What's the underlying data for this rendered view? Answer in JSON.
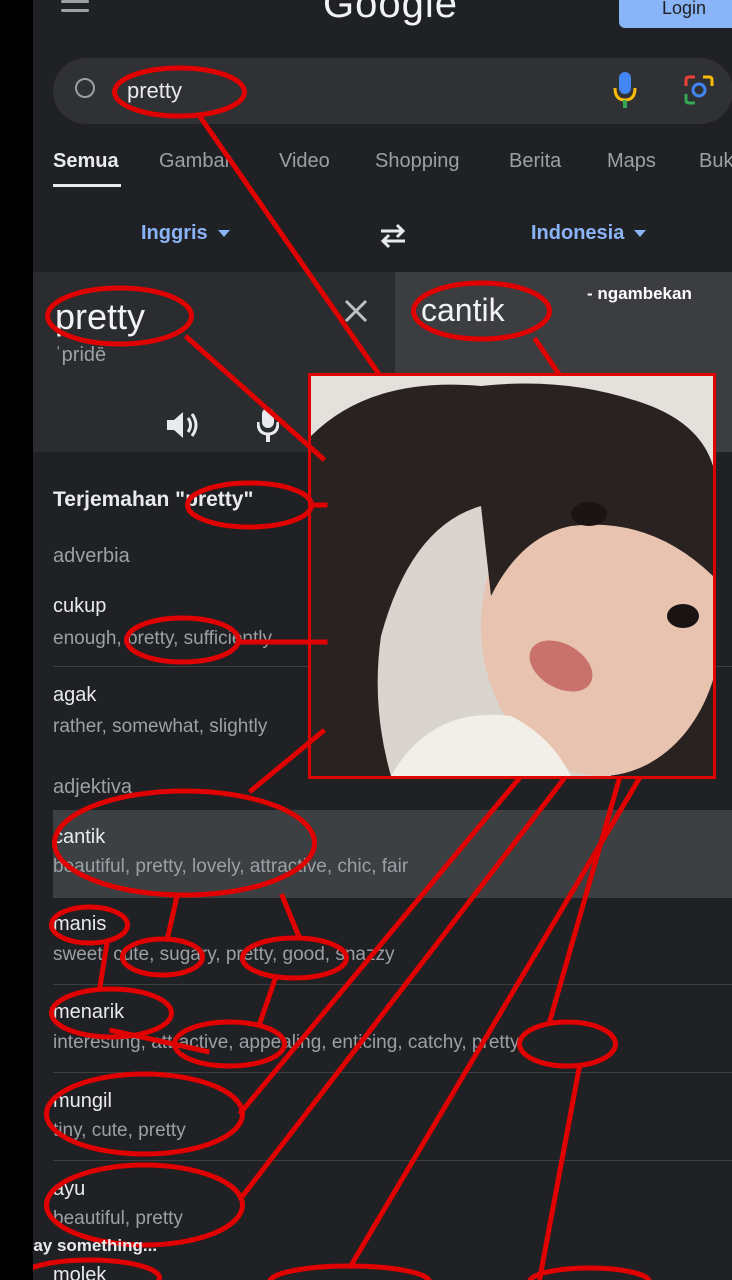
{
  "header": {
    "logo": "Google",
    "login_label": "Login"
  },
  "search": {
    "query": "pretty"
  },
  "tabs": [
    {
      "label": "Semua",
      "active": true
    },
    {
      "label": "Gambar"
    },
    {
      "label": "Video"
    },
    {
      "label": "Shopping"
    },
    {
      "label": "Berita"
    },
    {
      "label": "Maps"
    },
    {
      "label": "Buku"
    }
  ],
  "translate": {
    "source_lang": "Inggris",
    "target_lang": "Indonesia",
    "source_word": "pretty",
    "source_phonetic": "ˈpridē",
    "target_word": "cantik",
    "watermark": "- ngambekan"
  },
  "translations": {
    "title": "Terjemahan \"pretty\"",
    "groups": [
      {
        "pos": "adverbia",
        "entries": [
          {
            "word": "cukup",
            "synonyms": "enough, pretty, sufficiently"
          },
          {
            "word": "agak",
            "synonyms": "rather, somewhat, slightly"
          }
        ]
      },
      {
        "pos": "adjektiva",
        "entries": [
          {
            "word": "cantik",
            "synonyms": "beautiful, pretty, lovely, attractive, chic, fair"
          },
          {
            "word": "manis",
            "synonyms": "sweet, cute, sugary, pretty, good, snazzy"
          },
          {
            "word": "menarik",
            "synonyms": "interesting, attractive, appealing, enticing, catchy, pretty"
          },
          {
            "word": "mungil",
            "synonyms": "tiny, cute, pretty"
          },
          {
            "word": "ayu",
            "synonyms": "beautiful, pretty"
          },
          {
            "word": "molek",
            "synonyms": ""
          }
        ]
      }
    ]
  },
  "comment_placeholder": "Say something...",
  "colors": {
    "annotation": "#e00000",
    "background": "#202124",
    "accent": "#8ab4f8"
  },
  "icons": [
    "menu-icon",
    "search-icon",
    "mic-icon",
    "lens-icon",
    "swap-icon",
    "close-icon",
    "speaker-icon"
  ]
}
